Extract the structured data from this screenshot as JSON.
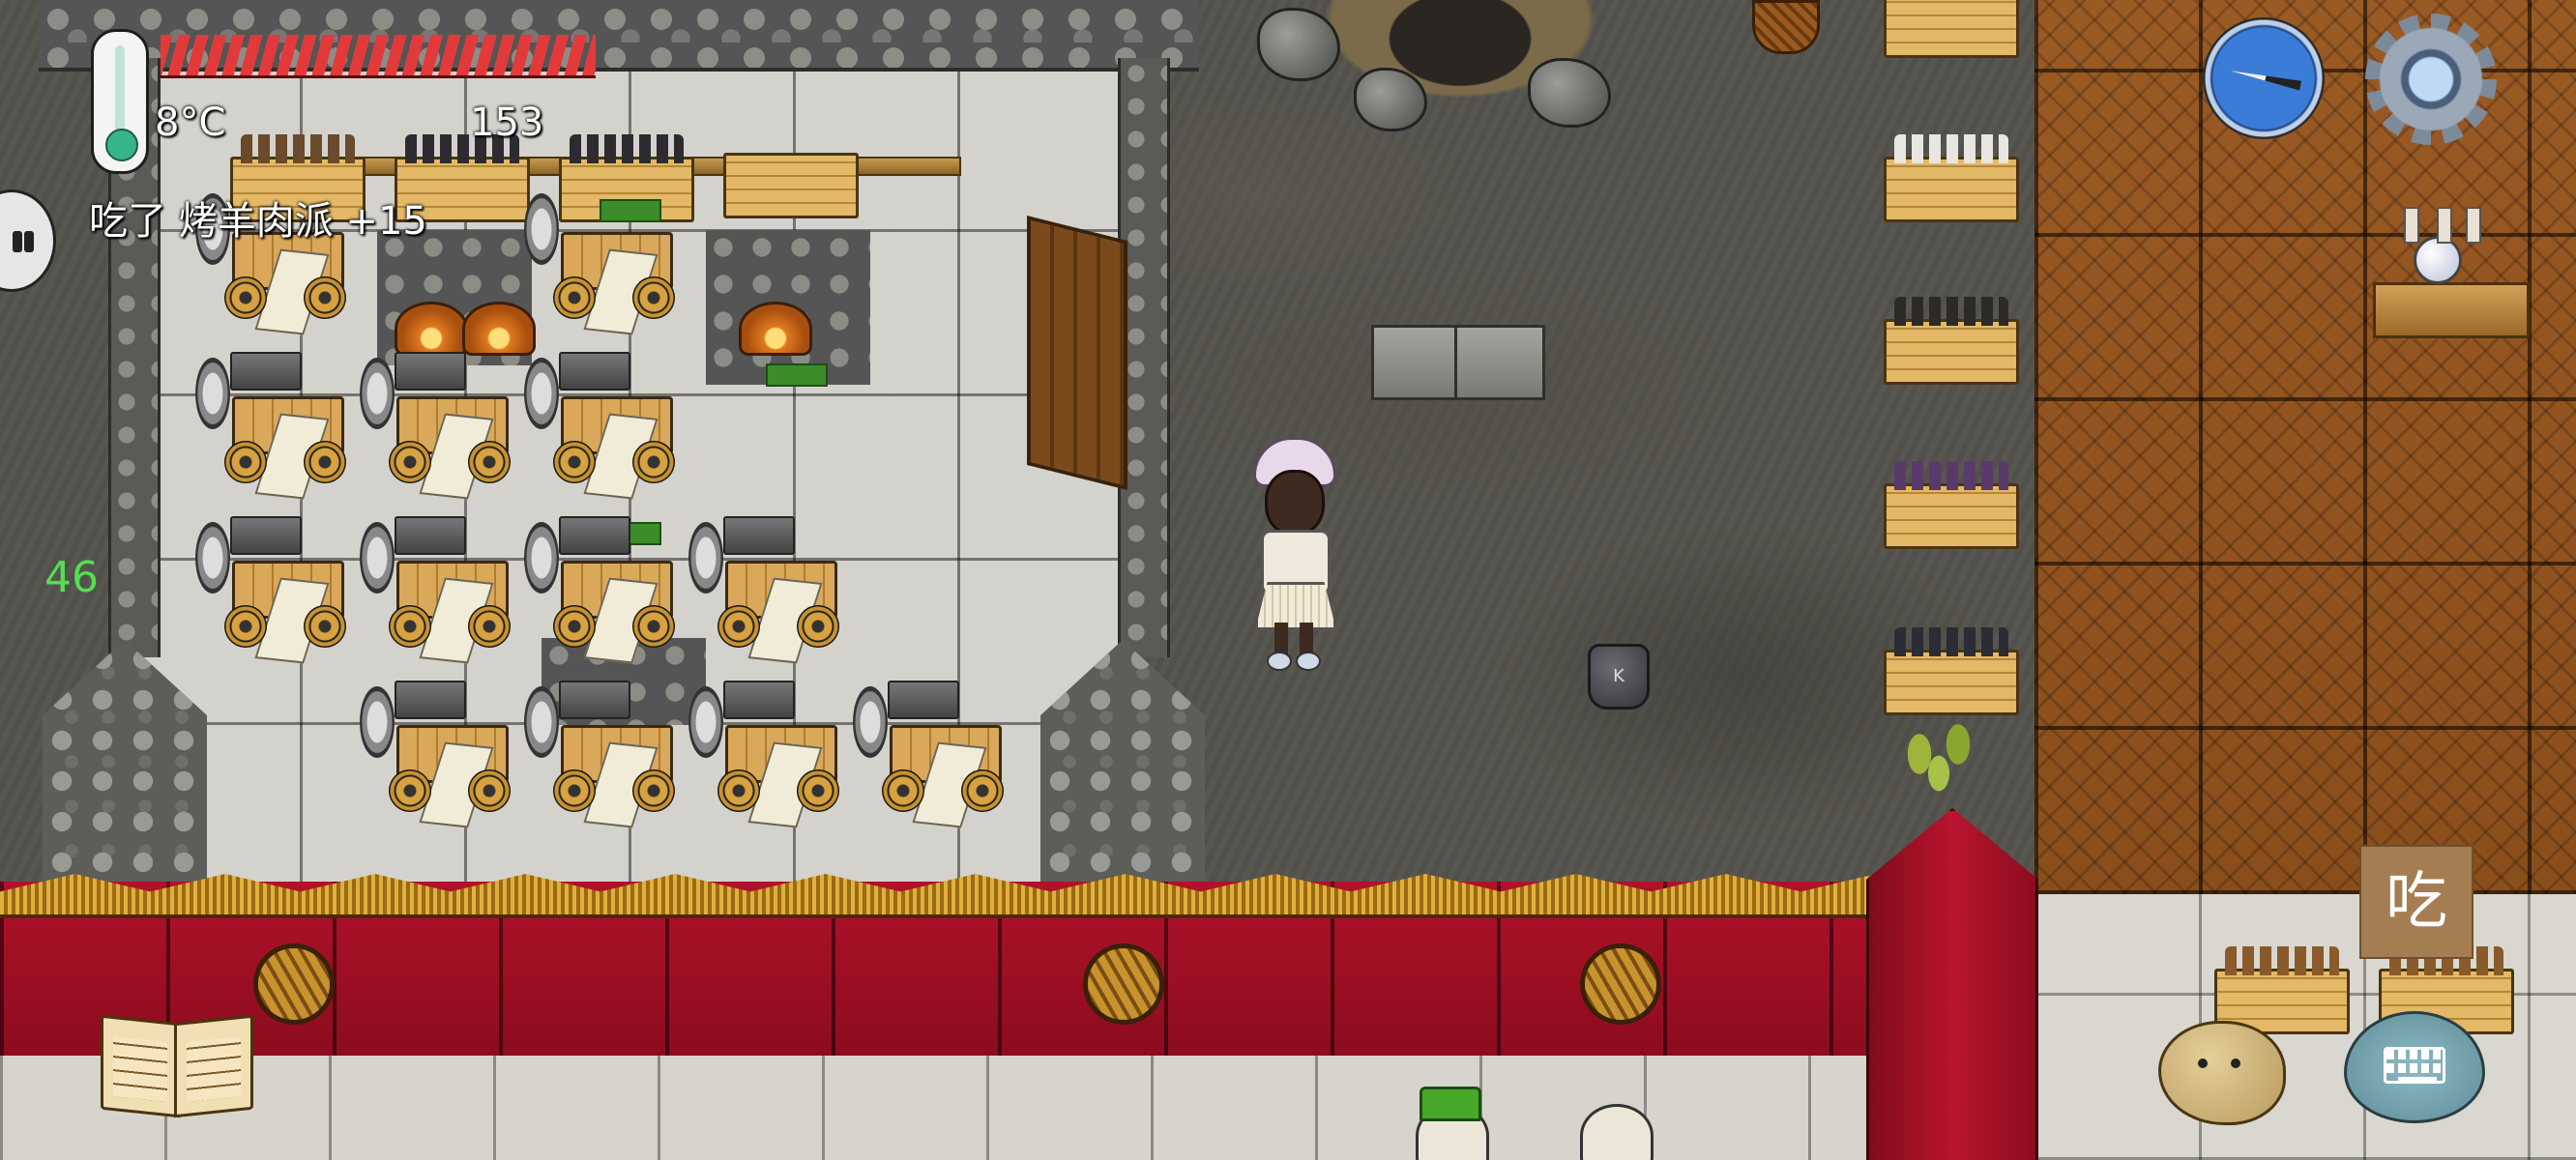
{
  "hud": {
    "temperature": "8°C",
    "food_value": "153",
    "message": "吃了 烤羊肉派 +15",
    "fps": "46",
    "health_fraction": 1.0
  },
  "buttons": {
    "eat_label": "吃"
  },
  "world": {
    "bag_letter": "K"
  },
  "colors": {
    "health": "#e23a3a",
    "fps": "#52e052",
    "eat_button": "#a57d52",
    "red_wall": "#b0122a"
  },
  "icons": {
    "thermometer": "thermometer-icon",
    "compass": "compass-icon",
    "settings": "gear-icon",
    "emote": "face-icon",
    "keyboard": "keyboard-icon",
    "tech_tree": "open-book-icon",
    "left_tab": "pause-icon"
  }
}
